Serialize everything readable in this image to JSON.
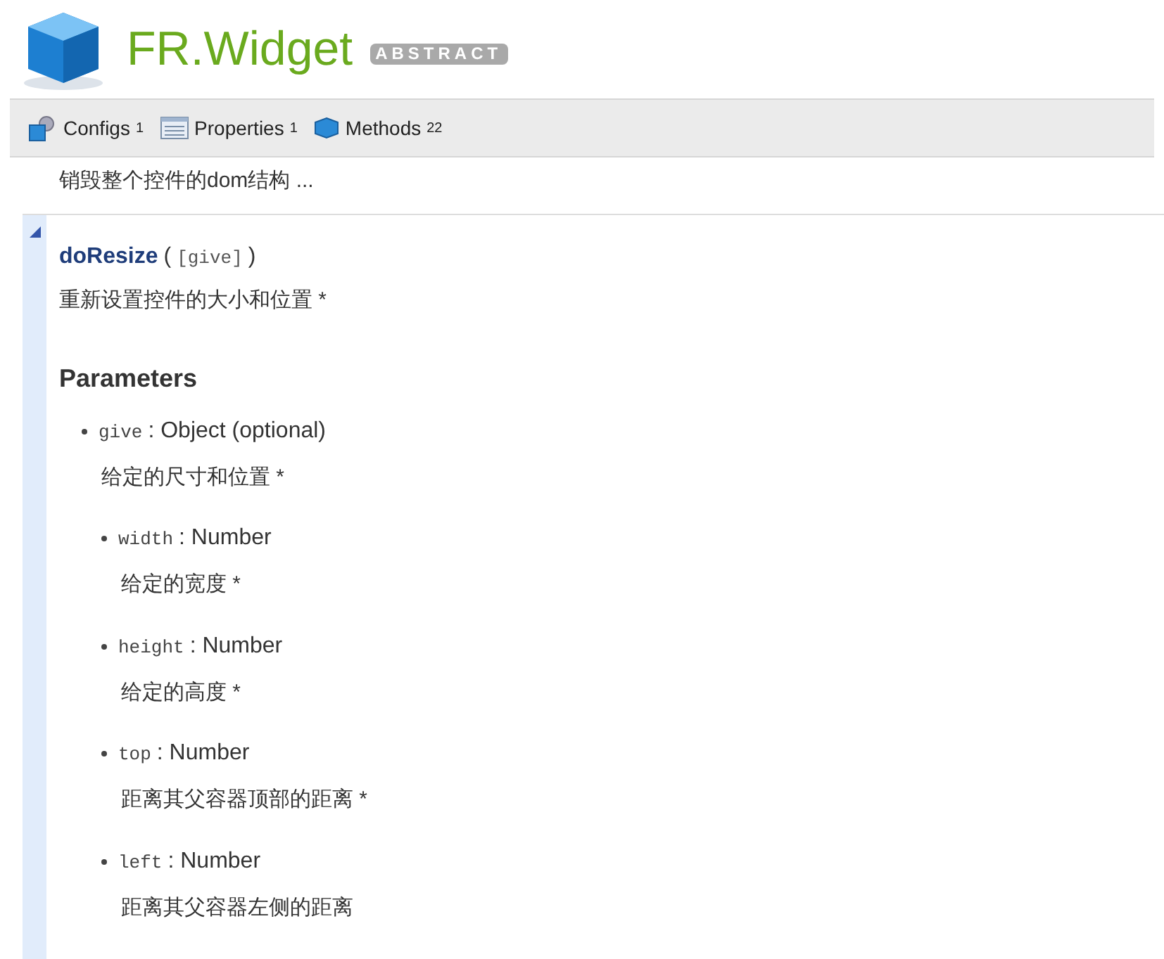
{
  "header": {
    "title": "FR.Widget",
    "badge": "ABSTRACT"
  },
  "toolbar": [
    {
      "kind": "configs",
      "label": "Configs",
      "count": "1"
    },
    {
      "kind": "properties",
      "label": "Properties",
      "count": "1"
    },
    {
      "kind": "methods",
      "label": "Methods",
      "count": "22"
    }
  ],
  "previous_summary": "销毁整个控件的dom结构 ...",
  "method": {
    "expanded": true,
    "name": "doResize",
    "signature_open": "(",
    "args": "[give]",
    "signature_close": ")",
    "description": "重新设置控件的大小和位置 *",
    "parameters_heading": "Parameters",
    "parameters": [
      {
        "name": "give",
        "type": ": Object (optional)",
        "description": "给定的尺寸和位置 *",
        "children": [
          {
            "name": "width",
            "type": ": Number",
            "description": "给定的宽度 *"
          },
          {
            "name": "height",
            "type": ": Number",
            "description": "给定的高度 *"
          },
          {
            "name": "top",
            "type": ": Number",
            "description": "距离其父容器顶部的距离 *"
          },
          {
            "name": "left",
            "type": ": Number",
            "description": "距离其父容器左侧的距离"
          }
        ]
      }
    ]
  }
}
